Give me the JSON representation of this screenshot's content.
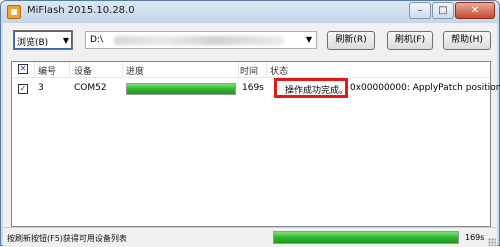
{
  "window": {
    "title": "MiFlash 2015.10.28.0",
    "controls": {
      "minimize": "–",
      "maximize": "□",
      "close": "✕"
    }
  },
  "toolbar": {
    "browse_combo": "浏览(B)",
    "path_prefix": "D:\\",
    "refresh_button": "刷新(R)",
    "flash_button": "刷机(F)",
    "help_button": "帮助(H)"
  },
  "list": {
    "columns": [
      "编号",
      "设备",
      "进度",
      "时间",
      "状态"
    ],
    "rows": [
      {
        "checked": true,
        "id": "3",
        "device": "COM52",
        "progress": 1.0,
        "time": "169s",
        "status": "操作成功完成。",
        "detail": "0x00000000: ApplyPatch position"
      }
    ]
  },
  "statusbar": {
    "message": "按刷新按钮(F5)获得可用设备列表",
    "progress": 1.0,
    "time": "169s"
  },
  "colors": {
    "progress_green": "#2fb52f",
    "highlight_red": "#e01a1a"
  }
}
